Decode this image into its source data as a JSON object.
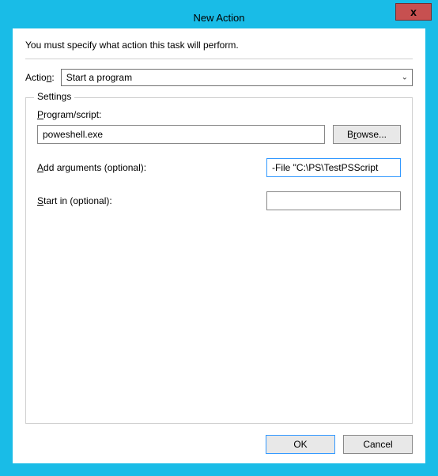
{
  "window": {
    "title": "New Action",
    "close_label": "x"
  },
  "intro": "You must specify what action this task will perform.",
  "action": {
    "label_pre": "Actio",
    "label_u": "n",
    "label_post": ":",
    "selected": "Start a program"
  },
  "settings": {
    "legend": "Settings",
    "program": {
      "label_u": "P",
      "label_post": "rogram/script:",
      "value": "poweshell.exe",
      "browse_pre": "B",
      "browse_u": "r",
      "browse_post": "owse..."
    },
    "arguments": {
      "label_u": "A",
      "label_post": "dd arguments (optional):",
      "value": "-File \"C:\\PS\\TestPSScript"
    },
    "startin": {
      "label_u": "S",
      "label_post": "tart in (optional):",
      "value": ""
    }
  },
  "buttons": {
    "ok": "OK",
    "cancel": "Cancel"
  }
}
